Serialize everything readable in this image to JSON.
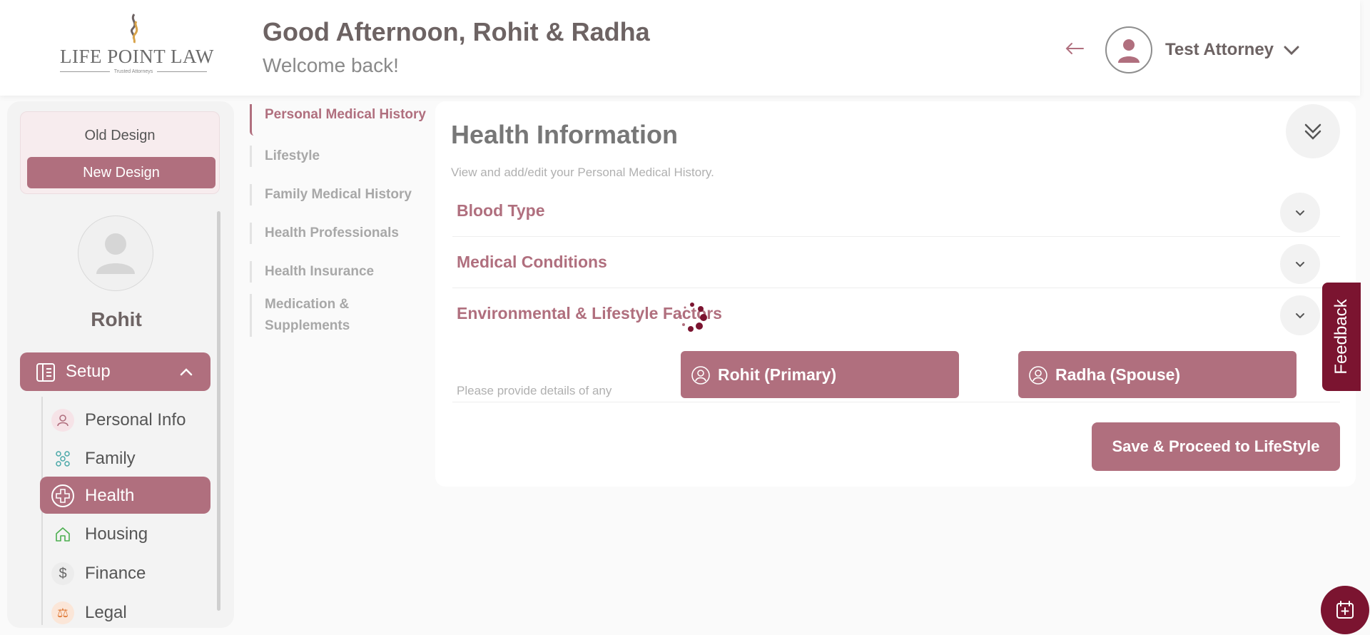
{
  "brand": {
    "name": "LIFE POINT LAW",
    "tagline": "Trusted Attorneys"
  },
  "header": {
    "greeting": "Good Afternoon, Rohit & Radha",
    "welcome": "Welcome back!",
    "user_name": "Test Attorney",
    "back_icon": "arrow-left-icon"
  },
  "sidebar": {
    "old_design": "Old Design",
    "new_design": "New Design",
    "profile_name": "Rohit",
    "setup_label": "Setup",
    "items": [
      {
        "label": "Personal Info",
        "icon": "person-icon",
        "active": false
      },
      {
        "label": "Family",
        "icon": "family-icon",
        "active": false
      },
      {
        "label": "Health",
        "icon": "medical-cross-icon",
        "active": true
      },
      {
        "label": "Housing",
        "icon": "house-icon",
        "active": false
      },
      {
        "label": "Finance",
        "icon": "dollar-icon",
        "active": false
      },
      {
        "label": "Legal",
        "icon": "legal-icon",
        "active": false
      }
    ]
  },
  "subnav": {
    "items": [
      {
        "label": "Personal Medical History",
        "active": true
      },
      {
        "label": "Lifestyle",
        "active": false
      },
      {
        "label": "Family Medical History",
        "active": false
      },
      {
        "label": "Health Professionals",
        "active": false
      },
      {
        "label": "Health Insurance",
        "active": false
      },
      {
        "label": "Medication & Supplements",
        "active": false
      }
    ]
  },
  "main": {
    "title": "Health Information",
    "subtitle": "View and add/edit your Personal Medical History.",
    "sections": [
      {
        "label": "Blood Type"
      },
      {
        "label": "Medical Conditions"
      },
      {
        "label": "Environmental & Lifestyle Factors"
      }
    ],
    "provide_text": "Please provide details of any",
    "persons": [
      {
        "label": "Rohit (Primary)"
      },
      {
        "label": "Radha (Spouse)"
      }
    ],
    "save_button": "Save & Proceed to LifeStyle"
  },
  "feedback": "Feedback",
  "colors": {
    "accent": "#b06f7e",
    "dark_accent": "#7b1430"
  }
}
